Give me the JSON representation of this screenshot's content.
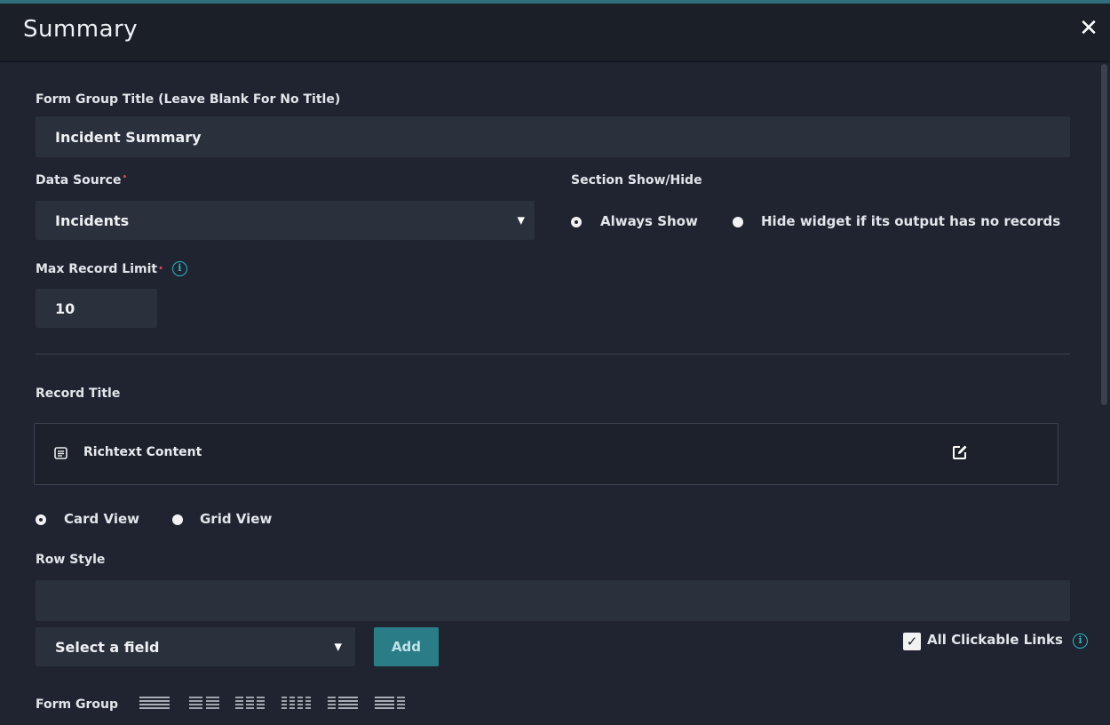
{
  "dialog": {
    "title": "Summary",
    "close_label": "✕"
  },
  "form_group_title": {
    "label": "Form Group Title (Leave Blank For No Title)",
    "value": "Incident Summary"
  },
  "data_source": {
    "label": "Data Source",
    "required": "•",
    "value": "Incidents"
  },
  "section_show_hide": {
    "label": "Section Show/Hide",
    "options": [
      "Always Show",
      "Hide widget if its output has no records"
    ],
    "selected": "Always Show"
  },
  "max_record_limit": {
    "label": "Max Record Limit",
    "required": "•",
    "info": "i",
    "value": "10"
  },
  "record_title": {
    "label": "Record Title",
    "content_label": "Richtext Content"
  },
  "view_mode": {
    "options": [
      "Card View",
      "Grid View"
    ],
    "selected": "Card View"
  },
  "row_style": {
    "label": "Row Style",
    "value": ""
  },
  "select_field": {
    "value": "Select a field",
    "add_label": "Add"
  },
  "clickable_links": {
    "label": "All Clickable Links",
    "checked": true,
    "check_glyph": "✓",
    "info": "i"
  },
  "form_group": {
    "label": "Form Group",
    "layouts": [
      "layout-1-column-icon",
      "layout-2-column-icon",
      "layout-3-column-icon",
      "layout-4-column-icon",
      "layout-1-2-column-icon",
      "layout-2-1-column-icon"
    ]
  },
  "colors": {
    "accent": "#2db3c6",
    "add_button": "#2a7c87",
    "input_bg": "#2a303c",
    "background": "#1f2430"
  }
}
